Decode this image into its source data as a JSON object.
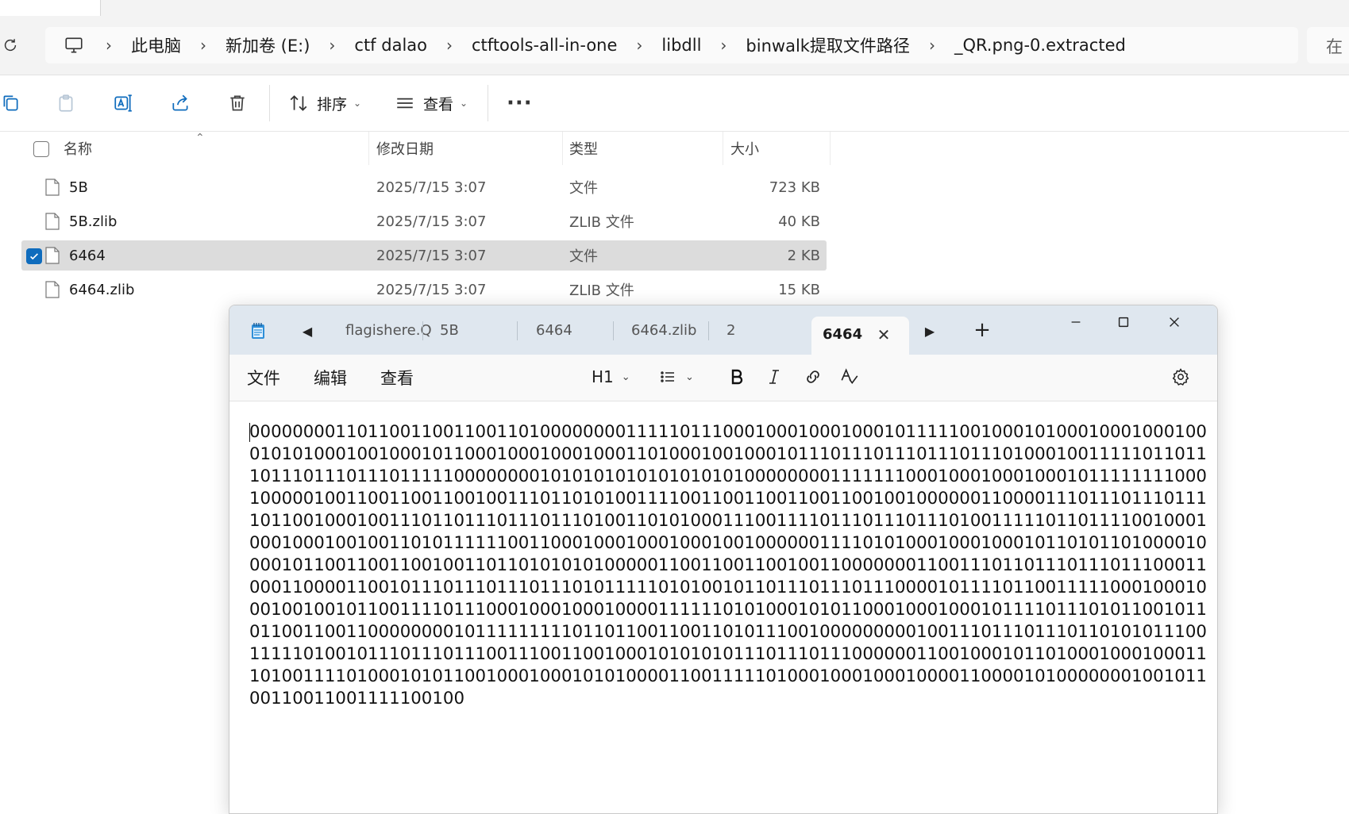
{
  "explorer": {
    "breadcrumb": [
      "此电脑",
      "新加卷 (E:)",
      "ctf dalao",
      "ctftools-all-in-one",
      "libdll",
      "binwalk提取文件路径",
      "_QR.png-0.extracted"
    ],
    "search_placeholder": "在",
    "commands": {
      "sort_label": "排序",
      "view_label": "查看"
    },
    "columns": {
      "name": "名称",
      "date": "修改日期",
      "type": "类型",
      "size": "大小"
    },
    "files": [
      {
        "name": "5B",
        "date": "2025/7/15 3:07",
        "type": "文件",
        "size": "723 KB",
        "selected": false
      },
      {
        "name": "5B.zlib",
        "date": "2025/7/15 3:07",
        "type": "ZLIB 文件",
        "size": "40 KB",
        "selected": false
      },
      {
        "name": "6464",
        "date": "2025/7/15 3:07",
        "type": "文件",
        "size": "2 KB",
        "selected": true
      },
      {
        "name": "6464.zlib",
        "date": "2025/7/15 3:07",
        "type": "ZLIB 文件",
        "size": "15 KB",
        "selected": false
      }
    ]
  },
  "notepad": {
    "tabs": [
      "flagishere.Q",
      "5B",
      "6464",
      "6464.zlib",
      "2"
    ],
    "active_tab": "6464",
    "menu": {
      "file": "文件",
      "edit": "编辑",
      "view": "查看"
    },
    "format": {
      "heading": "H1"
    },
    "content": "00000000110110011001100110100000000111110111000100010001000101111100100010100010001000100010101000100100010110001000100010001101000100100010111011101110111011101000100111110110111011101110111011111000000001010101010101010101000000001111111000100010001000101111111100010000010011001100110010011101101010011110011001100110011001001000000110000111011101110111101100100010011101101110111011101001101010001110011110111011101110100111110110111100100010001000100100110101111110011000100010001000100100000011110101000100010001011010110100001000010110011001100100110110101010100000110011001100100110000000110011101101110111011100011000110000110010111011101110111010111110101001011011101110111000010111101100111110001000100010010010110011110111000100010001000011111101010001010110001000100010111101110101100101101100110011000000001011111111101101100110011010111001000000000100111011101110110101011100111110100101110111011100111001100100010101010111011101110000001100100010110100010001000111010011110100010101100100010001010100001100111110100010001000100001100001010000000100101100110011001111100100"
  }
}
